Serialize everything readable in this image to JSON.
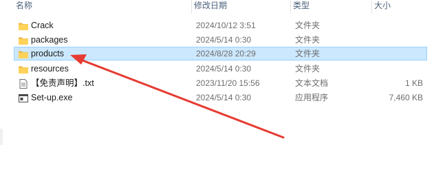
{
  "columns": {
    "name": "名称",
    "modified": "修改日期",
    "type": "类型",
    "size": "大小"
  },
  "files": [
    {
      "name": "Crack",
      "modified": "2024/10/12 3:51",
      "type": "文件夹",
      "size": "",
      "icon": "folder-icon"
    },
    {
      "name": "packages",
      "modified": "2024/5/14 0:30",
      "type": "文件夹",
      "size": "",
      "icon": "folder-icon"
    },
    {
      "name": "products",
      "modified": "2024/8/28 20:29",
      "type": "文件夹",
      "size": "",
      "icon": "folder-icon",
      "selected": true
    },
    {
      "name": "resources",
      "modified": "2024/5/14 0:30",
      "type": "文件夹",
      "size": "",
      "icon": "folder-icon"
    },
    {
      "name": "【免责声明】.txt",
      "modified": "2023/11/20 15:56",
      "type": "文本文档",
      "size": "1 KB",
      "icon": "text-file-icon"
    },
    {
      "name": "Set-up.exe",
      "modified": "2024/5/14 0:30",
      "type": "应用程序",
      "size": "7,460 KB",
      "icon": "exe-icon"
    }
  ],
  "colors": {
    "selection_bg": "#cce8ff",
    "selection_border": "#99d1ff",
    "folder": "#ffd25a",
    "annotation_arrow": "#e63b32"
  }
}
